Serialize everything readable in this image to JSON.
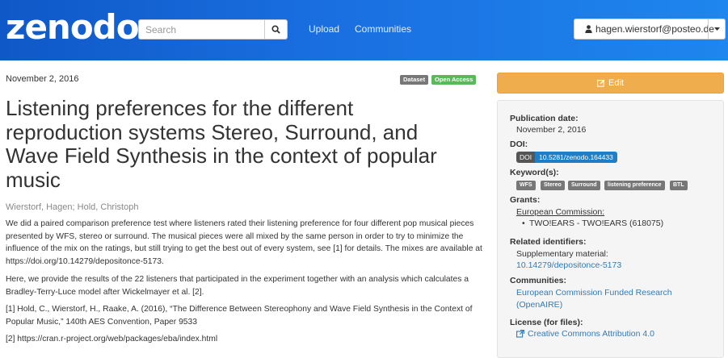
{
  "header": {
    "logo": "zenodo",
    "search_placeholder": "Search",
    "nav": [
      "Upload",
      "Communities"
    ],
    "user_email": "hagen.wierstorf@posteo.de"
  },
  "record": {
    "date": "November 2, 2016",
    "badges": [
      {
        "label": "Dataset",
        "color": "#777777"
      },
      {
        "label": "Open Access",
        "color": "#5cb85c"
      }
    ],
    "title": "Listening preferences for the different reproduction systems Stereo, Surround, and Wave Field Synthesis in the context of popular music",
    "authors": "Wierstorf, Hagen; Hold, Christoph",
    "paragraphs": [
      "We did a paired comparison preference test where listeners rated their listening preference for four different pop musical pieces presented by WFS, stereo or surround. The musical pieces were all mixed by the same person in order to try to minimize the influence of the mix on the ratings, but still trying to get the best out of every system, see [1] for details. The mixes are available at https://doi.org/10.14279/depositonce-5173.",
      "Here, we provide the results of the 22 listeners that participated in the experiment together with an analysis which calculates a Bradley-Terry-Luce model after Wickelmayer et al. [2].",
      "[1] Hold, C., Wierstorf, H., Raake, A. (2016), “The Difference Between Stereophony and Wave Field Synthesis in the Context of Popular Music,” 140th AES Convention, Paper 9533",
      "[2] https://cran.r-project.org/web/packages/eba/index.html"
    ]
  },
  "sidebar": {
    "edit_label": "Edit",
    "publication_date_label": "Publication date:",
    "publication_date": "November 2, 2016",
    "doi_label": "DOI:",
    "doi_prefix": "DOI",
    "doi": "10.5281/zenodo.164433",
    "keywords_label": "Keyword(s):",
    "keywords": [
      "WFS",
      "Stereo",
      "Surround",
      "listening preference",
      "BTL"
    ],
    "grants_label": "Grants:",
    "grant_funder": "European Commission:",
    "grant_item": "TWO!EARS - TWO!EARS (618075)",
    "related_label": "Related identifiers:",
    "related_type": "Supplementary material:",
    "related_link": "10.14279/depositonce-5173",
    "communities_label": "Communities:",
    "community": "European Commission Funded Research (OpenAIRE)",
    "license_label": "License (for files):",
    "license": "Creative Commons Attribution 4.0"
  },
  "colors": {
    "header_start": "#0f58c8",
    "header_end": "#1e86ee",
    "edit": "#f0ad4e",
    "link": "#337ab7"
  }
}
